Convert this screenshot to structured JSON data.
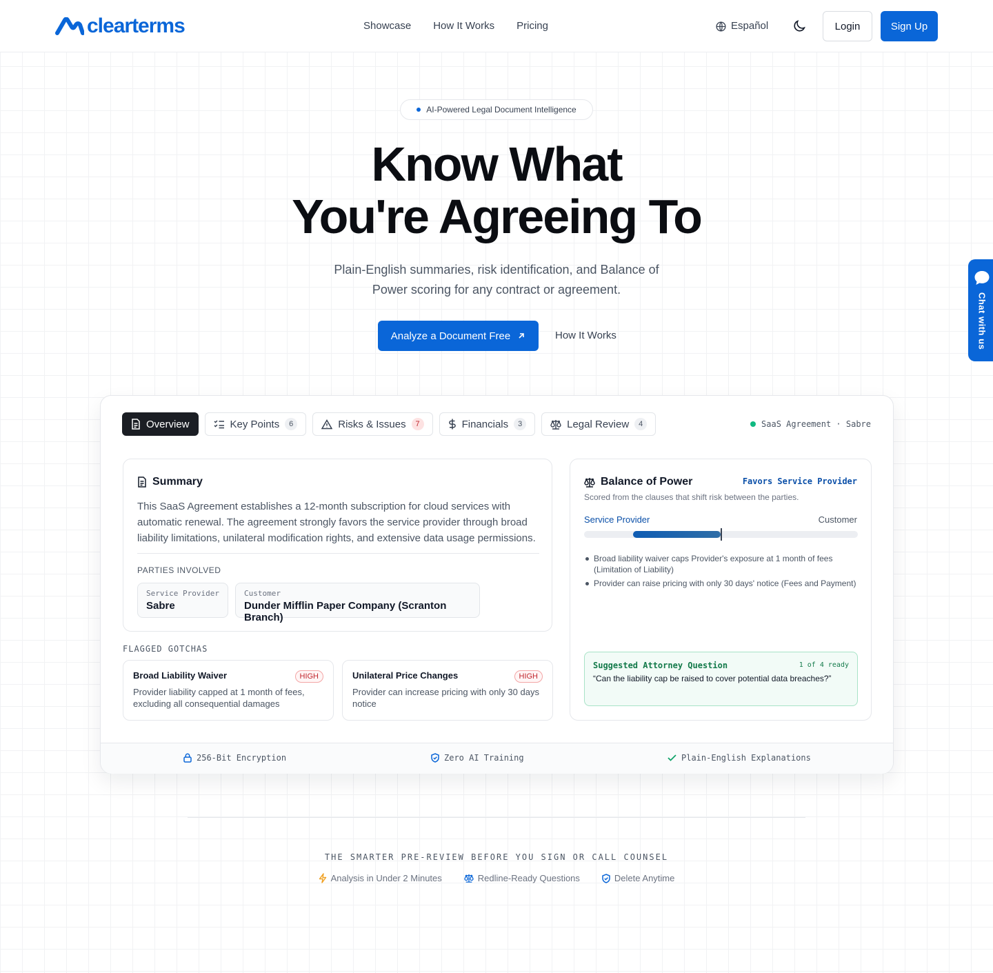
{
  "brand": {
    "name": "clearterms",
    "color": "#0a66d8"
  },
  "nav": {
    "items": [
      "Showcase",
      "How It Works",
      "Pricing"
    ]
  },
  "header": {
    "language": "Español",
    "login": "Login",
    "signup": "Sign Up"
  },
  "hero": {
    "badge": "AI-Powered Legal Document Intelligence",
    "title_line1": "Know What",
    "title_line2": "You're Agreeing To",
    "subtitle": "Plain-English summaries, risk identification, and Balance of Power scoring for any contract or agreement.",
    "cta_primary": "Analyze a Document Free",
    "cta_secondary": "How It Works"
  },
  "chat": {
    "label": "Chat with us"
  },
  "demo": {
    "tabs": [
      {
        "label": "Overview",
        "count": null
      },
      {
        "label": "Key Points",
        "count": "6"
      },
      {
        "label": "Risks & Issues",
        "count": "7"
      },
      {
        "label": "Financials",
        "count": "3"
      },
      {
        "label": "Legal Review",
        "count": "4"
      }
    ],
    "doc_label": "SaaS Agreement · Sabre",
    "summary": {
      "title": "Summary",
      "text": "This SaaS Agreement establishes a 12-month subscription for cloud services with automatic renewal. The agreement strongly favors the service provider through broad liability limitations, unilateral modification rights, and extensive data usage permissions.",
      "parties_heading": "PARTIES INVOLVED",
      "parties": [
        {
          "role": "Service Provider",
          "name": "Sabre"
        },
        {
          "role": "Customer",
          "name": "Dunder Mifflin Paper Company (Scranton Branch)"
        }
      ]
    },
    "gotchas": {
      "heading": "FLAGGED GOTCHAS",
      "items": [
        {
          "title": "Broad Liability Waiver",
          "severity": "HIGH",
          "text": "Provider liability capped at 1 month of fees, excluding all consequential damages"
        },
        {
          "title": "Unilateral Price Changes",
          "severity": "HIGH",
          "text": "Provider can increase pricing with only 30 days notice"
        }
      ]
    },
    "balance": {
      "title": "Balance of Power",
      "verdict": "Favors Service Provider",
      "scored_text": "Scored from the clauses that shift risk between the parties.",
      "left_label": "Service Provider",
      "right_label": "Customer",
      "score_start_fraction": 0.18,
      "score_end_fraction": 0.5,
      "bullets": [
        "Broad liability waiver caps Provider's exposure at 1 month of fees (Limitation of Liability)",
        "Provider can raise pricing with only 30 days' notice (Fees and Payment)"
      ],
      "question_label": "Suggested Attorney Question",
      "question_count": "1 of 4 ready",
      "question_text": "“Can the liability cap be raised to cover potential data breaches?”"
    },
    "trust": [
      "256-Bit Encryption",
      "Zero AI Training",
      "Plain-English Explanations"
    ]
  },
  "bottom": {
    "tagline": "THE SMARTER PRE-REVIEW BEFORE YOU SIGN OR CALL COUNSEL",
    "features": [
      "Analysis in Under 2 Minutes",
      "Redline-Ready Questions",
      "Delete Anytime"
    ]
  },
  "colors": {
    "accent": "#0a66d8",
    "danger": "#c0262d",
    "success": "#10b981",
    "dark": "#1b1e24"
  }
}
